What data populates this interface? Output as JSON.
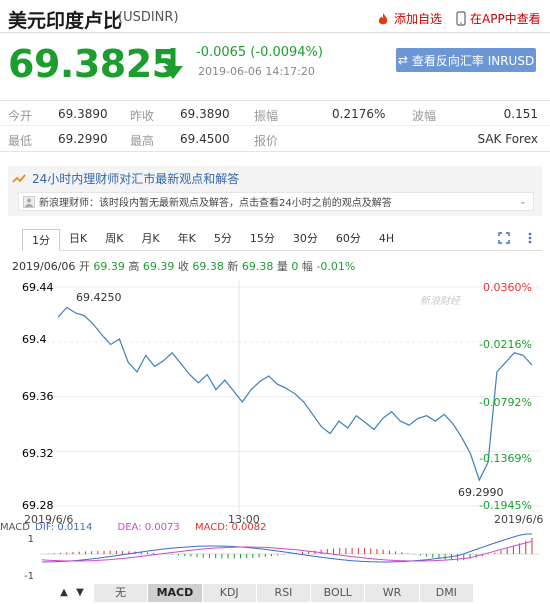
{
  "header": {
    "title": "美元印度卢比",
    "code": "(USDINR)",
    "add_watch": "添加自选",
    "app_view": "在APP中查看"
  },
  "quote": {
    "price": "69.3825",
    "change": "-0.0065 (-0.0094%)",
    "time": "2019-06-06 14:17:20",
    "reverse_button": "查看反向汇率 INRUSD",
    "down_color": "#1b9e2d"
  },
  "stats": {
    "open_label": "今开",
    "open": "69.3890",
    "prev_label": "昨收",
    "prev": "69.3890",
    "amp_label": "振幅",
    "amp": "0.2176%",
    "wave_label": "波幅",
    "wave": "0.151",
    "low_label": "最低",
    "low": "69.2990",
    "high_label": "最高",
    "high": "69.4500",
    "quote_label": "报价",
    "quote_src": "SAK Forex"
  },
  "expert": {
    "title": "24小时内理财师对汇市最新观点和解答",
    "line": "新浪理财师：该时段内暂无最新观点及解答，点击查看24小时之前的观点及解答"
  },
  "tabs": [
    "1分",
    "日K",
    "周K",
    "月K",
    "年K",
    "5分",
    "15分",
    "30分",
    "60分",
    "4H"
  ],
  "active_tab": "1分",
  "infoline": {
    "date": "2019/06/06",
    "open_k": "开",
    "open_v": "69.39",
    "high_k": "高",
    "high_v": "69.39",
    "close_k": "收",
    "close_v": "69.38",
    "new_k": "新",
    "new_v": "69.38",
    "vol_k": "量",
    "vol_v": "0",
    "amp_k": "幅",
    "amp_v": "-0.01%"
  },
  "chart": {
    "y_ticks": [
      "69.44",
      "69.4",
      "69.36",
      "69.32",
      "69.28"
    ],
    "pct_ticks": [
      "0.0360%",
      "-0.0216%",
      "-0.0792%",
      "-0.1369%",
      "-0.1945%"
    ],
    "high_label": "69.4250",
    "low_label": "69.2990",
    "x_left": "2019/6/6",
    "x_mid": "13:00",
    "x_right": "2019/6/6",
    "watermark": "新浪财经"
  },
  "macd": {
    "label": "MACD",
    "dif": "DIF: 0.0114",
    "dea": "DEA: 0.0073",
    "macd": "MACD: 0.0082",
    "y_ticks": [
      "1",
      "-1"
    ]
  },
  "bottom_tabs": [
    "无",
    "MACD",
    "KDJ",
    "RSI",
    "BOLL",
    "WR",
    "DMI"
  ],
  "active_bottom": "MACD",
  "chart_data": {
    "type": "line",
    "ylim": [
      69.28,
      69.44
    ],
    "series": [
      {
        "values": [
          69.418,
          69.425,
          69.421,
          69.419,
          69.413,
          69.405,
          69.398,
          69.402,
          69.385,
          69.378,
          69.39,
          69.382,
          69.386,
          69.392,
          69.384,
          69.376,
          69.37,
          69.376,
          69.365,
          69.372,
          69.364,
          69.356,
          69.365,
          69.371,
          69.375,
          69.369,
          69.366,
          69.362,
          69.356,
          69.347,
          69.338,
          69.333,
          69.342,
          69.337,
          69.346,
          69.341,
          69.336,
          69.344,
          69.349,
          69.342,
          69.339,
          69.344,
          69.346,
          69.342,
          69.347,
          69.34,
          69.33,
          69.318,
          69.299,
          69.312,
          69.378,
          69.385,
          69.392,
          69.39,
          69.383
        ]
      }
    ]
  }
}
